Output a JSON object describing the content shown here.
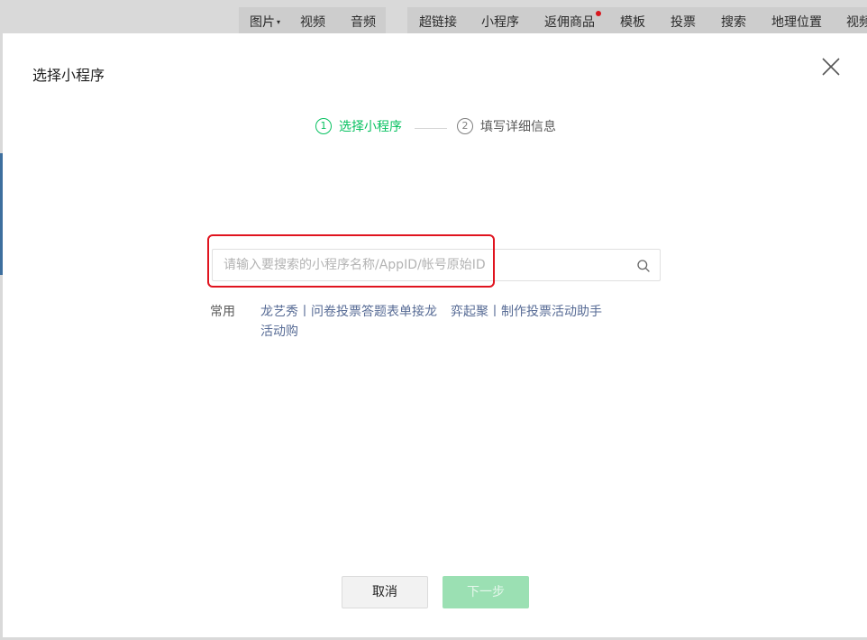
{
  "toolbar": {
    "items": [
      {
        "label": "图片"
      },
      {
        "label": "视频"
      },
      {
        "label": "音频"
      },
      {
        "label": "超链接"
      },
      {
        "label": "小程序"
      },
      {
        "label": "返佣商品"
      },
      {
        "label": "模板"
      },
      {
        "label": "投票"
      },
      {
        "label": "搜索"
      },
      {
        "label": "地理位置"
      },
      {
        "label": "视频"
      }
    ],
    "dot_color": "#d8171e"
  },
  "dialog": {
    "title": "选择小程序",
    "close_icon": "close-icon",
    "steps": [
      {
        "number": "1",
        "label": "选择小程序",
        "active": true
      },
      {
        "number": "2",
        "label": "填写详细信息",
        "active": false
      }
    ],
    "search": {
      "placeholder": "请输入要搜索的小程序名称/AppID/帐号原始ID",
      "value": "",
      "icon": "search-icon"
    },
    "common": {
      "label": "常用",
      "items": [
        "龙艺秀丨问卷投票答题表单接龙",
        "弈起聚丨制作投票活动助手",
        "活动购"
      ]
    },
    "buttons": {
      "cancel": "取消",
      "next": "下一步"
    }
  },
  "colors": {
    "accent": "#07c160",
    "link": "#576b95",
    "highlight": "#e0141f",
    "next_disabled": "#9be0b3"
  }
}
